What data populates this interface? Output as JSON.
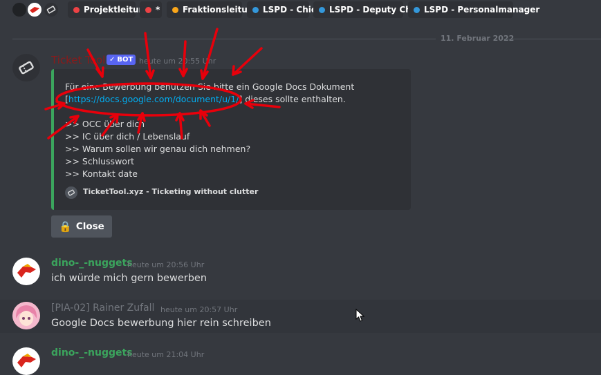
{
  "roles": [
    {
      "label": "Projektleitung",
      "color": "#ed4245"
    },
    {
      "label": "*",
      "color": "#ed4245"
    },
    {
      "label": "Fraktionsleitung",
      "color": "#faa61a"
    },
    {
      "label": "LSPD - Chief",
      "color": "#3498db"
    },
    {
      "label": "LSPD - Deputy Chief",
      "color": "#3498db"
    },
    {
      "label": "LSPD - Personalmanager",
      "color": "#3498db"
    }
  ],
  "date_divider": "11. Februar 2022",
  "messages": [
    {
      "author": "Ticket Tool",
      "author_color": "#8b1a1a",
      "bot_label": "BOT",
      "timestamp": "heute um 20:55 Uhr",
      "embed": {
        "line1": "Für eine Bewerbung benutzen Sie bitte ein Google Docs Dokument",
        "line2_prefix": "[",
        "link": "https://docs.google.com/document/u/1/",
        "line2_suffix": "] dieses sollte enthalten.",
        "items": [
          ">> OCC über dich",
          ">> IC über dich / Lebenslauf",
          ">> Warum sollen wir genau dich nehmen?",
          ">> Schlusswort",
          ">> Kontakt date"
        ],
        "footer": "TicketTool.xyz - Ticketing without clutter",
        "accent": "#3ba55d"
      },
      "button_label": "Close",
      "button_icon": "lock-icon"
    },
    {
      "author": "dino-_-nuggets",
      "author_color": "#3ba55d",
      "timestamp": "heute um 20:56 Uhr",
      "text": "ich würde mich gern bewerben"
    },
    {
      "author": "[PIA-02] Rainer Zufall",
      "author_color": "#72767d",
      "timestamp": "heute um 20:57 Uhr",
      "text": "Google Docs bewerbung hier rein schreiben"
    },
    {
      "author": "dino-_-nuggets",
      "author_color": "#3ba55d",
      "timestamp": "heute um 21:04 Uhr",
      "text": ""
    }
  ],
  "annotation_color": "#e8000b"
}
